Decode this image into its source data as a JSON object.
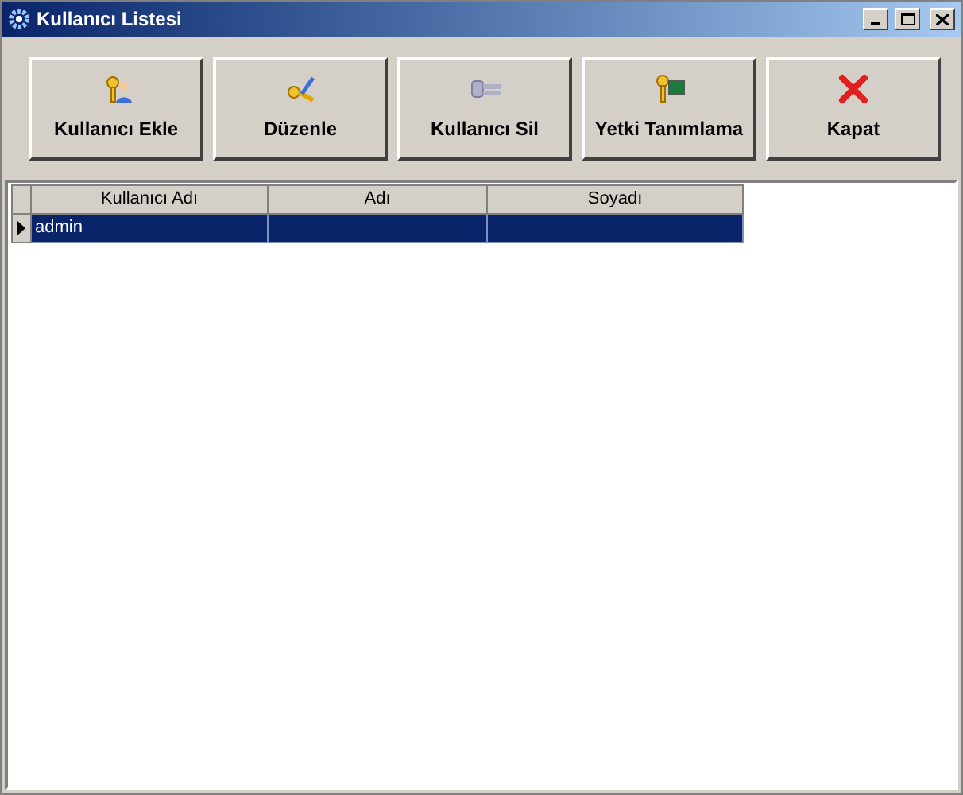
{
  "window": {
    "title": "Kullanıcı Listesi"
  },
  "toolbar": [
    {
      "label": "Kullanıcı Ekle",
      "kind": "add-user"
    },
    {
      "label": "Düzenle",
      "kind": "edit"
    },
    {
      "label": "Kullanıcı Sil",
      "kind": "delete-user"
    },
    {
      "label": "Yetki Tanımlama",
      "kind": "permissions"
    },
    {
      "label": "Kapat",
      "kind": "close"
    }
  ],
  "table": {
    "columns": [
      "Kullanıcı Adı",
      "Adı",
      "Soyadı"
    ],
    "rows": [
      {
        "cells": [
          "admin",
          "",
          ""
        ],
        "selected": true
      }
    ]
  }
}
